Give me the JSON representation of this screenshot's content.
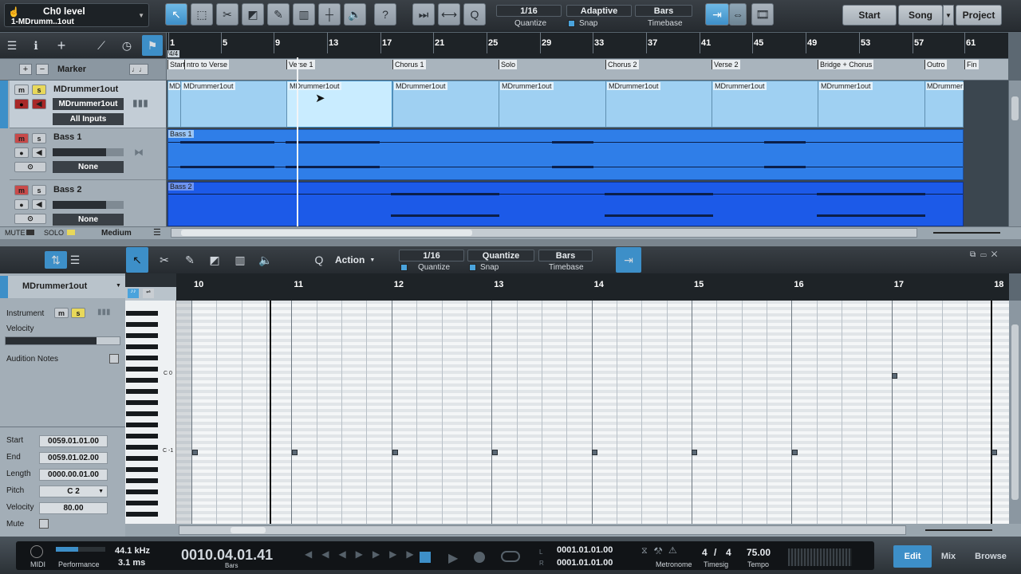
{
  "track_select": {
    "line1": "Ch0 level",
    "line2": "1-MDrumm..1out"
  },
  "quantize": {
    "value": "1/16",
    "label": "Quantize"
  },
  "snap": {
    "value": "Adaptive",
    "label": "Snap"
  },
  "timebase": {
    "value": "Bars",
    "label": "Timebase"
  },
  "pages": {
    "start": "Start",
    "song": "Song",
    "project": "Project"
  },
  "ruler": {
    "signature": "4/4",
    "bars": [
      "1",
      "5",
      "9",
      "13",
      "17",
      "21",
      "25",
      "29",
      "33",
      "37",
      "41",
      "45",
      "49",
      "53",
      "57",
      "61"
    ]
  },
  "markers": [
    "Start",
    "ntro to Verse",
    "Verse 1",
    "Chorus 1",
    "Solo",
    "Chorus 2",
    "Verse 2",
    "Bridge + Chorus",
    "Outro",
    "Fin"
  ],
  "arrange": {
    "marker_label": "Marker"
  },
  "tracks": [
    {
      "name": "MDrummer1out",
      "instrument": "MDrummer1out",
      "input": "All Inputs"
    },
    {
      "name": "Bass 1",
      "input": "None"
    },
    {
      "name": "Bass 2",
      "input": "None"
    }
  ],
  "clips": {
    "drum": "MDrummer1out",
    "drum_short": "MD",
    "bass1": "Bass 1",
    "bass2": "Bass 2",
    "drum_end": "MDrummer"
  },
  "bottom_arrange": {
    "mute": "MUTE",
    "solo": "SOLO",
    "size": "Medium"
  },
  "editor": {
    "action": "Action",
    "quantize": {
      "value": "1/16",
      "label": "Quantize"
    },
    "snap": {
      "value": "Quantize",
      "label": "Snap"
    },
    "timebase": {
      "value": "Bars",
      "label": "Timebase"
    },
    "track": "MDrummer1out",
    "bars": [
      "10",
      "11",
      "12",
      "13",
      "14",
      "15",
      "16",
      "17",
      "18"
    ],
    "key_labels": {
      "c0": "C 0",
      "cm1": "C -1"
    }
  },
  "inspector": {
    "instrument_label": "Instrument",
    "velocity_label": "Velocity",
    "audition_label": "Audition Notes",
    "start_label": "Start",
    "start": "0059.01.01.00",
    "end_label": "End",
    "end": "0059.01.02.00",
    "length_label": "Length",
    "length": "0000.00.01.00",
    "pitch_label": "Pitch",
    "pitch": "C 2",
    "note_velocity_label": "Velocity",
    "note_velocity": "80.00",
    "mute_label": "Mute"
  },
  "transport": {
    "midi": "MIDI",
    "performance": "Performance",
    "samplerate": "44.1 kHz",
    "latency": "3.1 ms",
    "position": "0010.04.01.41",
    "position_unit": "Bars",
    "loop_start": "0001.01.01.00",
    "loop_end": "0001.01.01.00",
    "metronome": "Metronome",
    "timesig_num": "4",
    "timesig_den": "4",
    "timesig_label": "Timesig",
    "tempo": "75.00",
    "tempo_label": "Tempo"
  },
  "views": {
    "edit": "Edit",
    "mix": "Mix",
    "browse": "Browse"
  },
  "colors": {
    "accent": "#3d8fc8",
    "drum_clip": "#9fd0f2",
    "bass_clip": "#2f7ee8",
    "bass2_clip": "#1c5ae8"
  }
}
